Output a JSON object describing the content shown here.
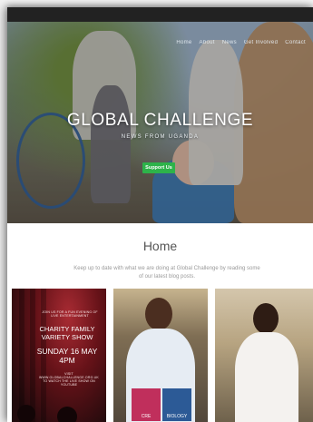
{
  "header": {
    "nav_items": [
      "Home",
      "About",
      "News",
      "Get Involved",
      "Contact"
    ]
  },
  "hero": {
    "title": "GLOBAL CHALLENGE",
    "subtitle": "NEWS FROM UGANDA",
    "button_label": "Support Us"
  },
  "main": {
    "heading": "Home",
    "intro_text": "Keep up to date with what we are doing at Global Challenge by reading some of our latest blog posts."
  },
  "cards": [
    {
      "type": "poster",
      "small_top": "JOIN US FOR A FUN EVENING OF LIVE ENTERTAINMENT",
      "title_line1": "CHARITY FAMILY",
      "title_line2": "VARIETY SHOW",
      "date_line1": "SUNDAY 16 MAY",
      "date_line2": "4PM",
      "small_bottom": "VISIT WWW.GLOBALCHALLENGE.ORG.UK TO WATCH THE LIVE SHOW ON YOUTUBE"
    },
    {
      "type": "photo",
      "book_left": "CRE",
      "book_right": "BIOLOGY"
    },
    {
      "type": "photo"
    }
  ]
}
